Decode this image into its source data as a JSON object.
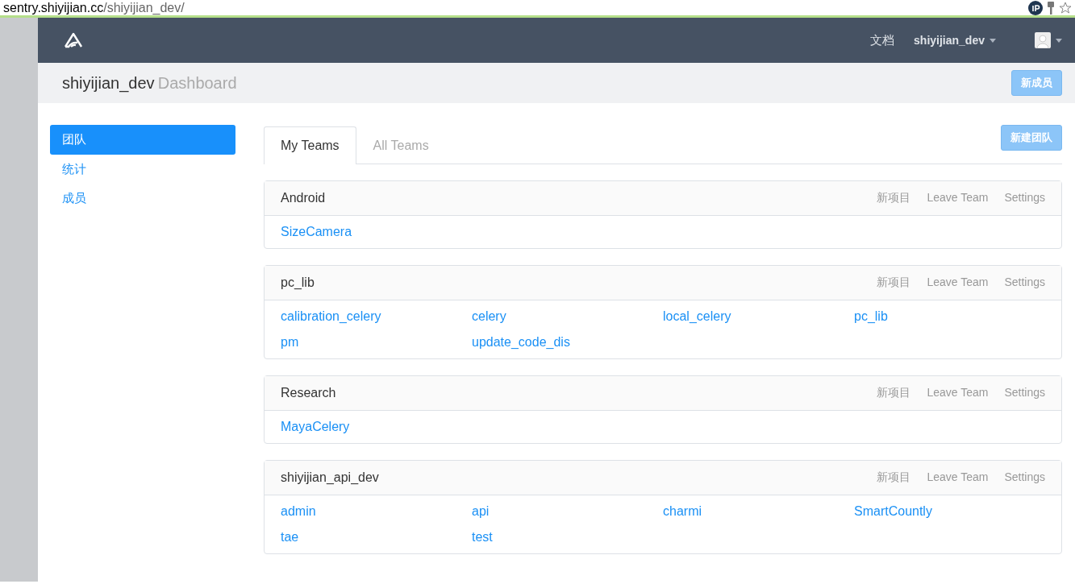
{
  "browser": {
    "url_host": "sentry.shiyijian.cc",
    "url_path": "/shiyijian_dev/"
  },
  "navbar": {
    "docs": "文档",
    "org": "shiyijian_dev"
  },
  "header": {
    "title": "shiyijian_dev",
    "subtitle": "Dashboard",
    "button": "新成员"
  },
  "sidebar": {
    "items": [
      {
        "label": "团队",
        "selected": true
      },
      {
        "label": "统计",
        "selected": false
      },
      {
        "label": "成员",
        "selected": false
      }
    ]
  },
  "tabs": [
    {
      "label": "My Teams",
      "selected": true
    },
    {
      "label": "All Teams",
      "selected": false
    }
  ],
  "new_team_button": "新建团队",
  "teams": [
    {
      "name": "Android",
      "actions": [
        "新项目",
        "Leave Team",
        "Settings"
      ],
      "projects": [
        "SizeCamera"
      ]
    },
    {
      "name": "pc_lib",
      "actions": [
        "新项目",
        "Leave Team",
        "Settings"
      ],
      "projects": [
        "calibration_celery",
        "celery",
        "local_celery",
        "pc_lib",
        "pm",
        "update_code_dis"
      ]
    },
    {
      "name": "Research",
      "actions": [
        "新项目",
        "Leave Team",
        "Settings"
      ],
      "projects": [
        "MayaCelery"
      ]
    },
    {
      "name": "shiyijian_api_dev",
      "actions": [
        "新项目",
        "Leave Team",
        "Settings"
      ],
      "projects": [
        "admin",
        "api",
        "charmi",
        "SmartCountly",
        "tae",
        "test"
      ]
    }
  ]
}
